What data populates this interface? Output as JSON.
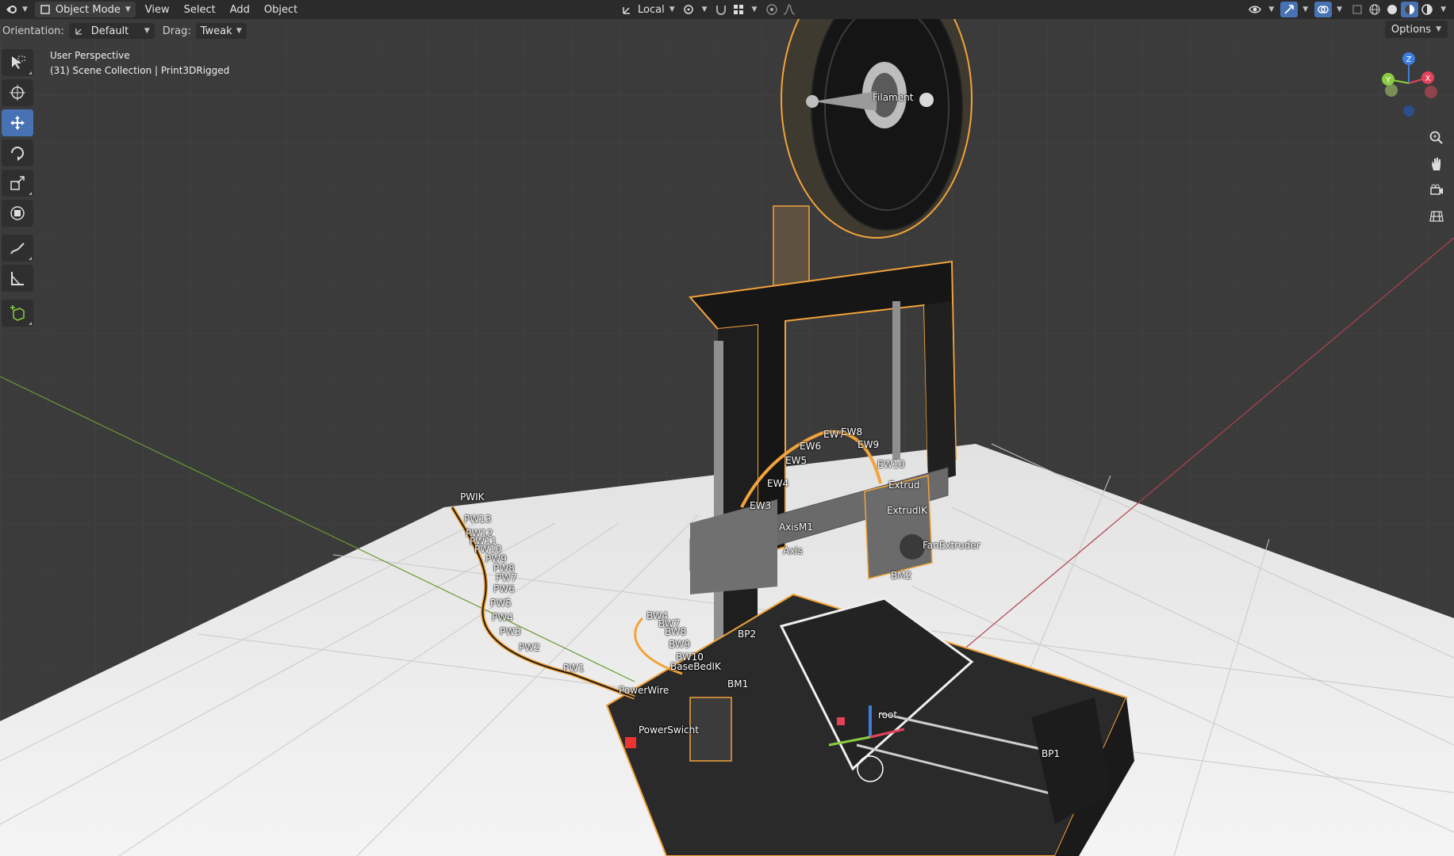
{
  "header": {
    "mode": "Object Mode",
    "menus": [
      "View",
      "Select",
      "Add",
      "Object"
    ],
    "transform_orientation": "Local"
  },
  "tool_settings": {
    "orientation_label": "Orientation:",
    "orientation_value": "Default",
    "drag_label": "Drag:",
    "drag_value": "Tweak",
    "options_label": "Options"
  },
  "viewport": {
    "perspective": "User Perspective",
    "collection": "(31) Scene Collection | Print3DRigged",
    "gizmo_axes": [
      "X",
      "Y",
      "Z"
    ]
  },
  "toolbar": {
    "tools": [
      "select-box",
      "cursor",
      "move",
      "rotate",
      "scale",
      "transform",
      "annotate",
      "measure",
      "add-cube"
    ],
    "active_tool": "move"
  },
  "bones": [
    {
      "key": "filament",
      "label": "Filament"
    },
    {
      "key": "pwik",
      "label": "PWIK"
    },
    {
      "key": "pw13",
      "label": "PW13"
    },
    {
      "key": "pw12",
      "label": "PW12"
    },
    {
      "key": "pw11",
      "label": "PW11"
    },
    {
      "key": "pw10",
      "label": "PW10"
    },
    {
      "key": "pw9",
      "label": "PW9"
    },
    {
      "key": "pw8",
      "label": "PW8"
    },
    {
      "key": "pw7",
      "label": "PW7"
    },
    {
      "key": "pw6",
      "label": "PW6"
    },
    {
      "key": "pw5",
      "label": "PW5"
    },
    {
      "key": "pw4",
      "label": "PW4"
    },
    {
      "key": "pw3",
      "label": "PW3"
    },
    {
      "key": "pw2",
      "label": "PW2"
    },
    {
      "key": "pw1",
      "label": "PW1"
    },
    {
      "key": "powerwire",
      "label": "PowerWire"
    },
    {
      "key": "powerswicht",
      "label": "PowerSwicht"
    },
    {
      "key": "ew3",
      "label": "EW3"
    },
    {
      "key": "ew4",
      "label": "EW4"
    },
    {
      "key": "ew5",
      "label": "EW5"
    },
    {
      "key": "ew6",
      "label": "EW6"
    },
    {
      "key": "ew7",
      "label": "EW7"
    },
    {
      "key": "ew8",
      "label": "EW8"
    },
    {
      "key": "ew9",
      "label": "EW9"
    },
    {
      "key": "ew10",
      "label": "EW10"
    },
    {
      "key": "extrud",
      "label": "Extrud"
    },
    {
      "key": "extrudik",
      "label": "ExtrudIK"
    },
    {
      "key": "axism1",
      "label": "AxisM1"
    },
    {
      "key": "axis",
      "label": "Axis"
    },
    {
      "key": "fanextruder",
      "label": "FanExtruder"
    },
    {
      "key": "bm2",
      "label": "BM2"
    },
    {
      "key": "bp2",
      "label": "BP2"
    },
    {
      "key": "bm1",
      "label": "BM1"
    },
    {
      "key": "root",
      "label": "root"
    },
    {
      "key": "bp1",
      "label": "BP1"
    },
    {
      "key": "bw4",
      "label": "BW4"
    },
    {
      "key": "bw7",
      "label": "BW7"
    },
    {
      "key": "bw8",
      "label": "BW8"
    },
    {
      "key": "bw9",
      "label": "BW9"
    },
    {
      "key": "bw10",
      "label": "BW10"
    },
    {
      "key": "basebedik",
      "label": "BaseBedIK"
    }
  ],
  "colors": {
    "header_bg": "#2b2b2b",
    "viewport_bg": "#3b3b3b",
    "active_tool": "#4772b3",
    "selection_outline": "#f2a33a",
    "axis_x": "#e2435a",
    "axis_y": "#8bcd40",
    "axis_z": "#3c7fe0"
  }
}
